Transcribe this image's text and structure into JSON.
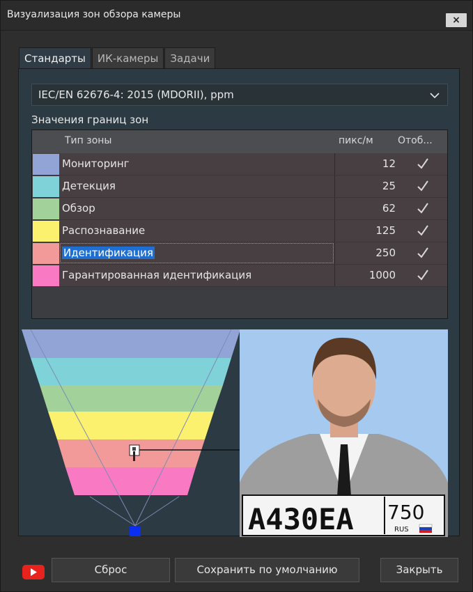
{
  "window": {
    "title": "Визуализация зон обзора камеры",
    "close_label": "×"
  },
  "tabs": [
    {
      "label": "Стандарты",
      "active": true
    },
    {
      "label": "ИК-камеры",
      "active": false
    },
    {
      "label": "Задачи",
      "active": false
    }
  ],
  "standard": {
    "selected": "IEC/EN 62676-4: 2015 (MDORII), ppm"
  },
  "zones_label": "Значения границ зон",
  "table": {
    "headers": {
      "type": "Тип зоны",
      "ppm": "пикс/м",
      "show": "Отоб..."
    },
    "rows": [
      {
        "name": "Мониторинг",
        "value": "12",
        "color": "#92a4d6",
        "shown": true
      },
      {
        "name": "Детекция",
        "value": "25",
        "color": "#7fd2d8",
        "shown": true
      },
      {
        "name": "Обзор",
        "value": "62",
        "color": "#a2d29a",
        "shown": true
      },
      {
        "name": "Распознавание",
        "value": "125",
        "color": "#fbf16e",
        "shown": true
      },
      {
        "name": "Идентификация",
        "value": "250",
        "color": "#f29a9a",
        "shown": true,
        "selected": true
      },
      {
        "name": "Гарантированная идентификация",
        "value": "1000",
        "color": "#fa79c3",
        "shown": true
      }
    ]
  },
  "plate": {
    "number": "A430EA",
    "region": "750",
    "country": "RUS"
  },
  "buttons": {
    "reset": "Сброс",
    "save_default": "Сохранить по умолчанию",
    "close": "Закрыть"
  },
  "icons": {
    "youtube": "youtube-icon",
    "chevron": "chevron-down-icon",
    "check": "check-icon"
  }
}
